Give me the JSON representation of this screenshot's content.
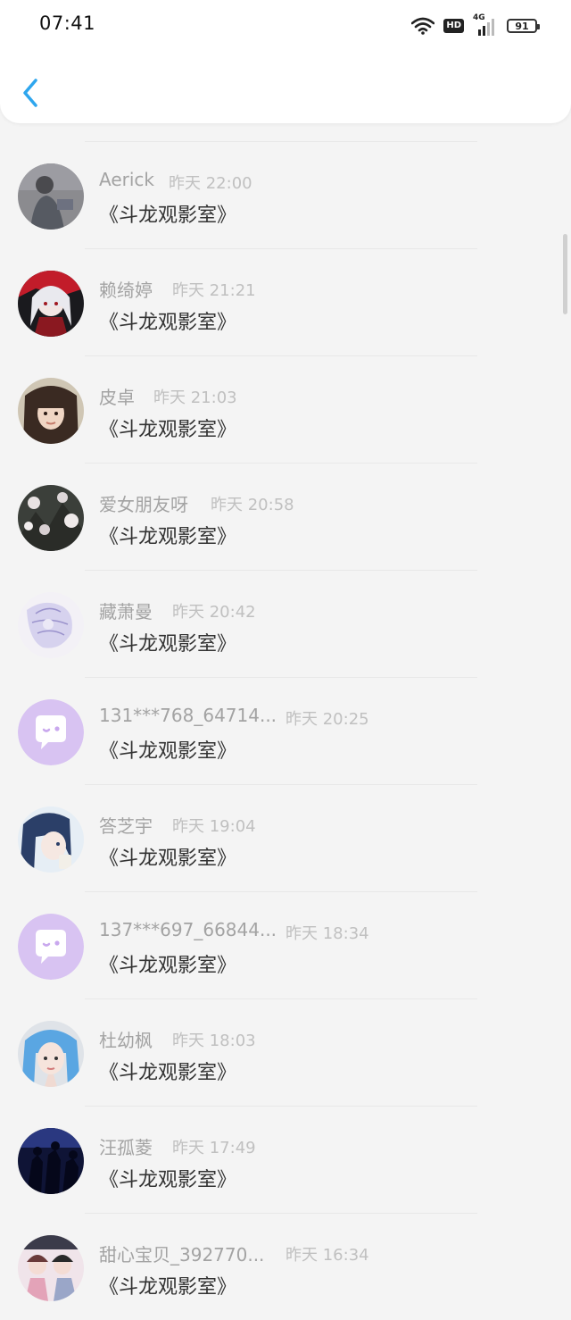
{
  "status_bar": {
    "time": "07:41",
    "hd": "HD",
    "network": "4G",
    "battery": "91"
  },
  "list": [
    {
      "nickname": "Aerick",
      "time": "昨天 22:00",
      "message": "《斗龙观影室》",
      "avatar": "photo-gray"
    },
    {
      "nickname": "赖绮婷",
      "time": "昨天 21:21",
      "message": "《斗龙观影室》",
      "avatar": "anime-red"
    },
    {
      "nickname": "皮卓",
      "time": "昨天 21:03",
      "message": "《斗龙观影室》",
      "avatar": "photo-girl"
    },
    {
      "nickname": "爱女朋友呀",
      "time": "昨天 20:58",
      "message": "《斗龙观影室》",
      "avatar": "photo-blossom"
    },
    {
      "nickname": "藏萧曼",
      "time": "昨天 20:42",
      "message": "《斗龙观影室》",
      "avatar": "anime-sketch"
    },
    {
      "nickname": "131***768_64714...",
      "time": "昨天 20:25",
      "message": "《斗龙观影室》",
      "avatar": "default-chat"
    },
    {
      "nickname": "答芝宇",
      "time": "昨天 19:04",
      "message": "《斗龙观影室》",
      "avatar": "anime-blue"
    },
    {
      "nickname": "137***697_66844...",
      "time": "昨天 18:34",
      "message": "《斗龙观影室》",
      "avatar": "default-chat"
    },
    {
      "nickname": "杜幼枫",
      "time": "昨天 18:03",
      "message": "《斗龙观影室》",
      "avatar": "photo-bluehair"
    },
    {
      "nickname": "汪孤菱",
      "time": "昨天 17:49",
      "message": "《斗龙观影室》",
      "avatar": "photo-dark"
    },
    {
      "nickname": "甜心宝贝_392770...",
      "time": "昨天 16:34",
      "message": "《斗龙观影室》",
      "avatar": "photo-pink"
    }
  ],
  "colors": {
    "accent": "#2ea6ee",
    "default_avatar_bg": "#d8c3f2",
    "nickname": "#a3a3a3",
    "time": "#c0c0c0",
    "message": "#333333",
    "background": "#f4f4f4"
  }
}
